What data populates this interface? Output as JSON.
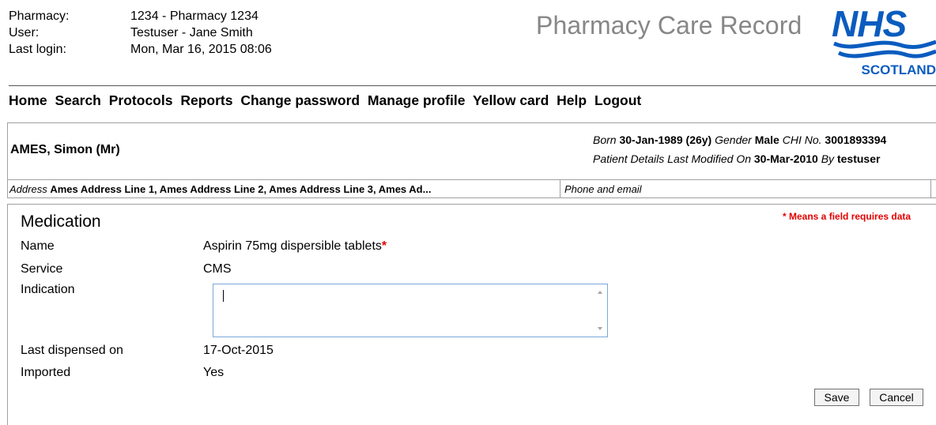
{
  "header": {
    "pharmacy_label": "Pharmacy:",
    "pharmacy_value": "1234 - Pharmacy 1234",
    "user_label": "User:",
    "user_value": "Testuser - Jane Smith",
    "last_login_label": "Last login:",
    "last_login_value": "Mon, Mar 16, 2015 08:06",
    "app_title": "Pharmacy Care Record",
    "logo_nhs": "NHS",
    "logo_scotland": "SCOTLAND",
    "logo_color": "#0a5cbf"
  },
  "nav": {
    "items": [
      {
        "label": "Home"
      },
      {
        "label": "Search"
      },
      {
        "label": "Protocols"
      },
      {
        "label": "Reports"
      },
      {
        "label": "Change password"
      },
      {
        "label": "Manage profile"
      },
      {
        "label": "Yellow card"
      },
      {
        "label": "Help"
      },
      {
        "label": "Logout"
      }
    ]
  },
  "patient": {
    "name": "AMES, Simon (Mr)",
    "born_label": "Born",
    "born_value": "30-Jan-1989",
    "age": "(26y)",
    "gender_label": "Gender",
    "gender_value": "Male",
    "chi_label": "CHI No.",
    "chi_value": "3001893394",
    "modified_label": "Patient Details Last Modified On",
    "modified_value": "30-Mar-2010",
    "by_label": "By",
    "by_value": "testuser",
    "address_label": "Address",
    "address_value": "Ames Address Line 1, Ames Address Line 2, Ames Address Line 3, Ames Ad...",
    "phone_label": "Phone and email"
  },
  "medication": {
    "title": "Medication",
    "required_note": "* Means a field requires data",
    "required_color": "#e30000",
    "name_label": "Name",
    "name_value": "Aspirin 75mg dispersible tablets",
    "required_star": "*",
    "service_label": "Service",
    "service_value": "CMS",
    "indication_label": "Indication",
    "indication_value": "",
    "last_dispensed_label": "Last dispensed on",
    "last_dispensed_value": "17-Oct-2015",
    "imported_label": "Imported",
    "imported_value": "Yes",
    "save_label": "Save",
    "cancel_label": "Cancel"
  }
}
